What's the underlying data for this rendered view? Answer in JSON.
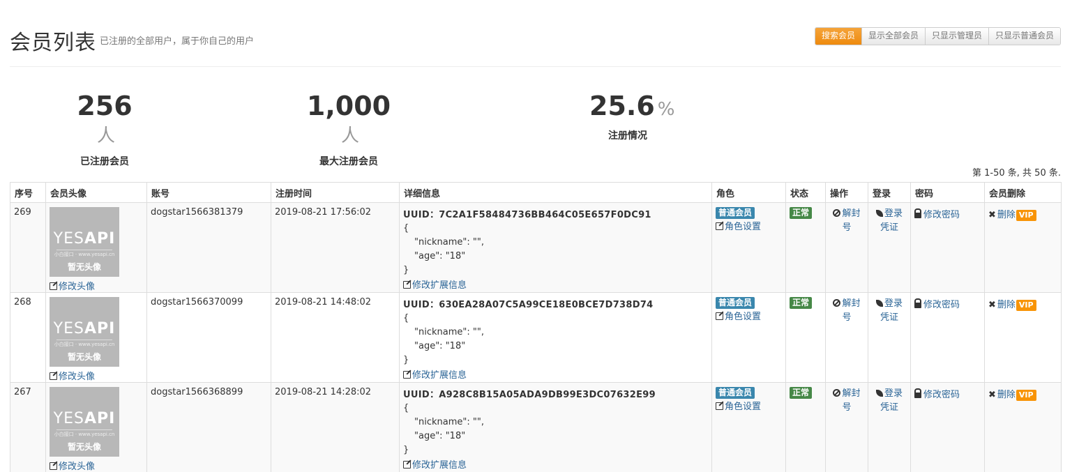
{
  "header": {
    "title": "会员列表",
    "subtitle": "已注册的全部用户，属于你自己的用户"
  },
  "filters": [
    {
      "label": "搜索会员",
      "active": true
    },
    {
      "label": "显示全部会员",
      "active": false
    },
    {
      "label": "只显示管理员",
      "active": false
    },
    {
      "label": "只显示普通会员",
      "active": false
    }
  ],
  "stats": [
    {
      "value": "256",
      "unit": "人",
      "label": "已注册会员"
    },
    {
      "value": "1,000",
      "unit": "人",
      "label": "最大注册会员"
    },
    {
      "value": "25.6",
      "unit": "%",
      "label": "注册情况"
    }
  ],
  "pager": "第 1-50 条, 共 50 条.",
  "table": {
    "columns": [
      "序号",
      "会员头像",
      "账号",
      "注册时间",
      "详细信息",
      "角色",
      "状态",
      "操作",
      "登录",
      "密码",
      "会员删除"
    ],
    "avatar_logo_a": "YES",
    "avatar_logo_b": "API",
    "avatar_tiny": "小白接口 · www.yesapi.cn",
    "avatar_none": "暂无头像",
    "edit_avatar": "修改头像",
    "uuid_prefix": "UUID：",
    "edit_ext": "修改扩展信息",
    "role": "普通会员",
    "role_set": "角色设置",
    "status": "正常",
    "unban_1": "解封",
    "unban_2": "号",
    "login_1": "登录",
    "login_2": "凭证",
    "change_pwd": "修改密码",
    "delete": "删除",
    "vip": "VIP",
    "json_open": "{",
    "json_close": "}",
    "json_nickname": "\"nickname\": \"\",",
    "json_age": "\"age\": \"18\"",
    "rows": [
      {
        "id": "269",
        "account": "dogstar1566381379",
        "time": "2019-08-21 17:56:02",
        "uuid": "7C2A1F58484736BB464C05E657F0DC91"
      },
      {
        "id": "268",
        "account": "dogstar1566370099",
        "time": "2019-08-21 14:48:02",
        "uuid": "630EA28A07C5A99CE18E0BCE7D738D74"
      },
      {
        "id": "267",
        "account": "dogstar1566368899",
        "time": "2019-08-21 14:28:02",
        "uuid": "A928C8B15A05ADA9DB99E3DC07632E99"
      }
    ]
  },
  "colors": {
    "active_button": "#ee8a0e",
    "role_label": "#3a87ad",
    "status_label": "#468847",
    "vip_label": "#f89406",
    "link": "#2a6496"
  },
  "icons": [
    "edit-icon",
    "ban-icon",
    "leaf-icon",
    "lock-icon",
    "close-icon"
  ]
}
